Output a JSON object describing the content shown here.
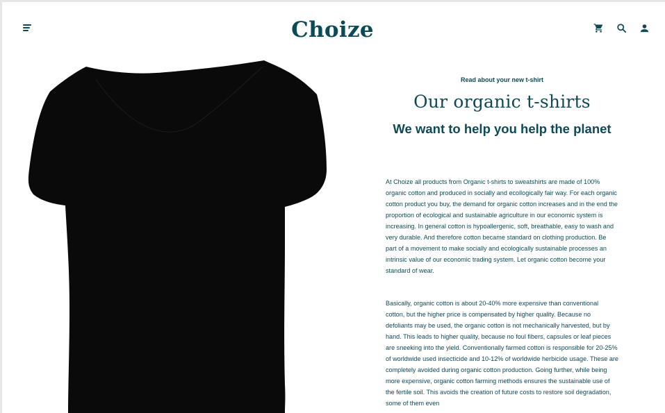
{
  "header": {
    "logo": "Choize",
    "icons": [
      "menu-icon",
      "cart-icon",
      "search-icon",
      "user-icon"
    ]
  },
  "hero": {
    "image_alt": "black t-shirt",
    "shirt_color": "#0a0a0a"
  },
  "article": {
    "eyebrow": "Read about your new t-shirt",
    "title": "Our organic t-shirts",
    "subtitle": "We want to help you help the planet",
    "paragraph1": "At Choize all products from Organic t-shirts to sweatshirts are made of 100% organic cotton and produced in socially and ecollogically fair way. For each organic cotton product you buy, the demand for organic cotton increases and in the end the proportion of ecological and sustainable agriculture in our economic system is increasing. In general cotton is hypoallergenic, soft, breathable, easy to wash and very durable. And therefore cotton became standard on clothing production. Be part of a movement to make socially and ecologically sustainable processes an intrinsic value of our economic trading system. Let organic cotton become your standard of wear.",
    "paragraph2": "Basically, organic cotton is about 20-40% more expensive than conventional cotton, but the higher price is compensated by higher quality. Because no defoliants may be used, the organic cotton is not mechanically harvested, but by hand. This leads to higher quality, because no foul fibers, capsules or leaf pieces are sneeking into the yield.  Conventionally farmed cotton is responsible for 20-25% of worldwide used insecticide and 10-12% of worldwide herbicide usage. These are completely avoided during organic cotton production. Going further, while being more expensive, organic cotton farming methods ensures the sustainable use of the fertile soil. This avoids the creation of future costs to restore soil degradation, some of them even"
  },
  "colors": {
    "brand": "#0d4a57",
    "background": "#ffffff"
  }
}
